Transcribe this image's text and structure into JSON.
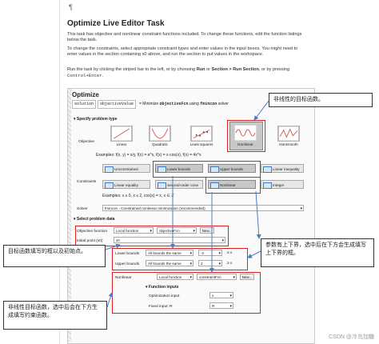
{
  "doc": {
    "marker": "¶",
    "title": "Optimize Live Editor Task",
    "para1": "This task has objective and nonlinear constraint functions included. To change these functions, edit the function listings below the task.",
    "para2": "To change the constraints, select appropriate constraint types and enter values in the input boxes. You might need to enter values in the section containing x0 above, and run the section to put values in the workspace.",
    "para3_a": "Run the task by clicking the striped bar to the left, or by choosing ",
    "para3_run": "Run",
    "para3_b": " or ",
    "para3_section": "Section > Run Section",
    "para3_c": ", or by pressing ",
    "para3_key": "Control+Enter",
    "para3_d": "."
  },
  "task": {
    "title": "Optimize",
    "output1": "solution",
    "output2": "objectiveValue",
    "equals_text": "= Minimize ",
    "func_name": "objectiveFcn",
    "using_text": " using ",
    "solver_name": "fmincon",
    "solver_suffix": " solver",
    "spec_section": "Specify problem type",
    "objective_label": "Objective",
    "objective_types": [
      "Linear",
      "Quadratic",
      "Least squares",
      "Nonlinear",
      "Nonsmooth"
    ],
    "examples1": "Examples: f(x, y) = x/y,  f(x) = e^x,  f(x) = x·cos(x),  f(x) = 4x^x",
    "constraints_label": "Constraints",
    "constraint_buttons": [
      "Unconstrained",
      "Lower bounds",
      "Upper bounds",
      "Linear inequality",
      "Linear equality",
      "Second-order cone",
      "Nonlinear",
      "Integer"
    ],
    "examples2": "Examples: x ≥ 0,  x ≤ 2,  cos(x) = x,  x ∈ ℤ",
    "solver_label": "Solver",
    "solver_value": "fmincon - Constrained nonlinear minimization (recommended)",
    "select_section": "Select problem data",
    "objfun_label": "Objective function",
    "objfun_type": "Local function",
    "objfun_value": "objectiveFcn",
    "new_label": "New...",
    "x0_label": "Initial point (x0)",
    "x0_value": "x0",
    "lb_label": "Lower bounds",
    "lb_mode": "All bounds the same",
    "lb_value": "-2",
    "lb_sym": "≤ x",
    "ub_label": "Upper bounds",
    "ub_mode": "All bounds the same",
    "ub_value": "2",
    "ub_sym": "≥ x",
    "nl_label": "Nonlinear",
    "nl_type": "Local function",
    "nl_value": "constraintFcn",
    "fi_section": "Function inputs",
    "opt_input_label": "Optimization input",
    "opt_input_value": "x",
    "fixed_input_label": "Fixed input: R",
    "fixed_input_value": "R"
  },
  "annotations": {
    "nonlinear_objective": "非线性的目标函数。",
    "objfun_init": "目标函数填写的框以及初始点。",
    "bounds_note": "参数有上下界，选中后在下方会生成填写上下界的框。",
    "nl_constraint_note": "非线性目标函数，选中后会在下方生成填写约束函数。"
  },
  "watermark": "CSDN @冷鸟加糖",
  "colors": {
    "highlight_red": "#e02020",
    "arrow_blue": "#4a7cc7"
  }
}
